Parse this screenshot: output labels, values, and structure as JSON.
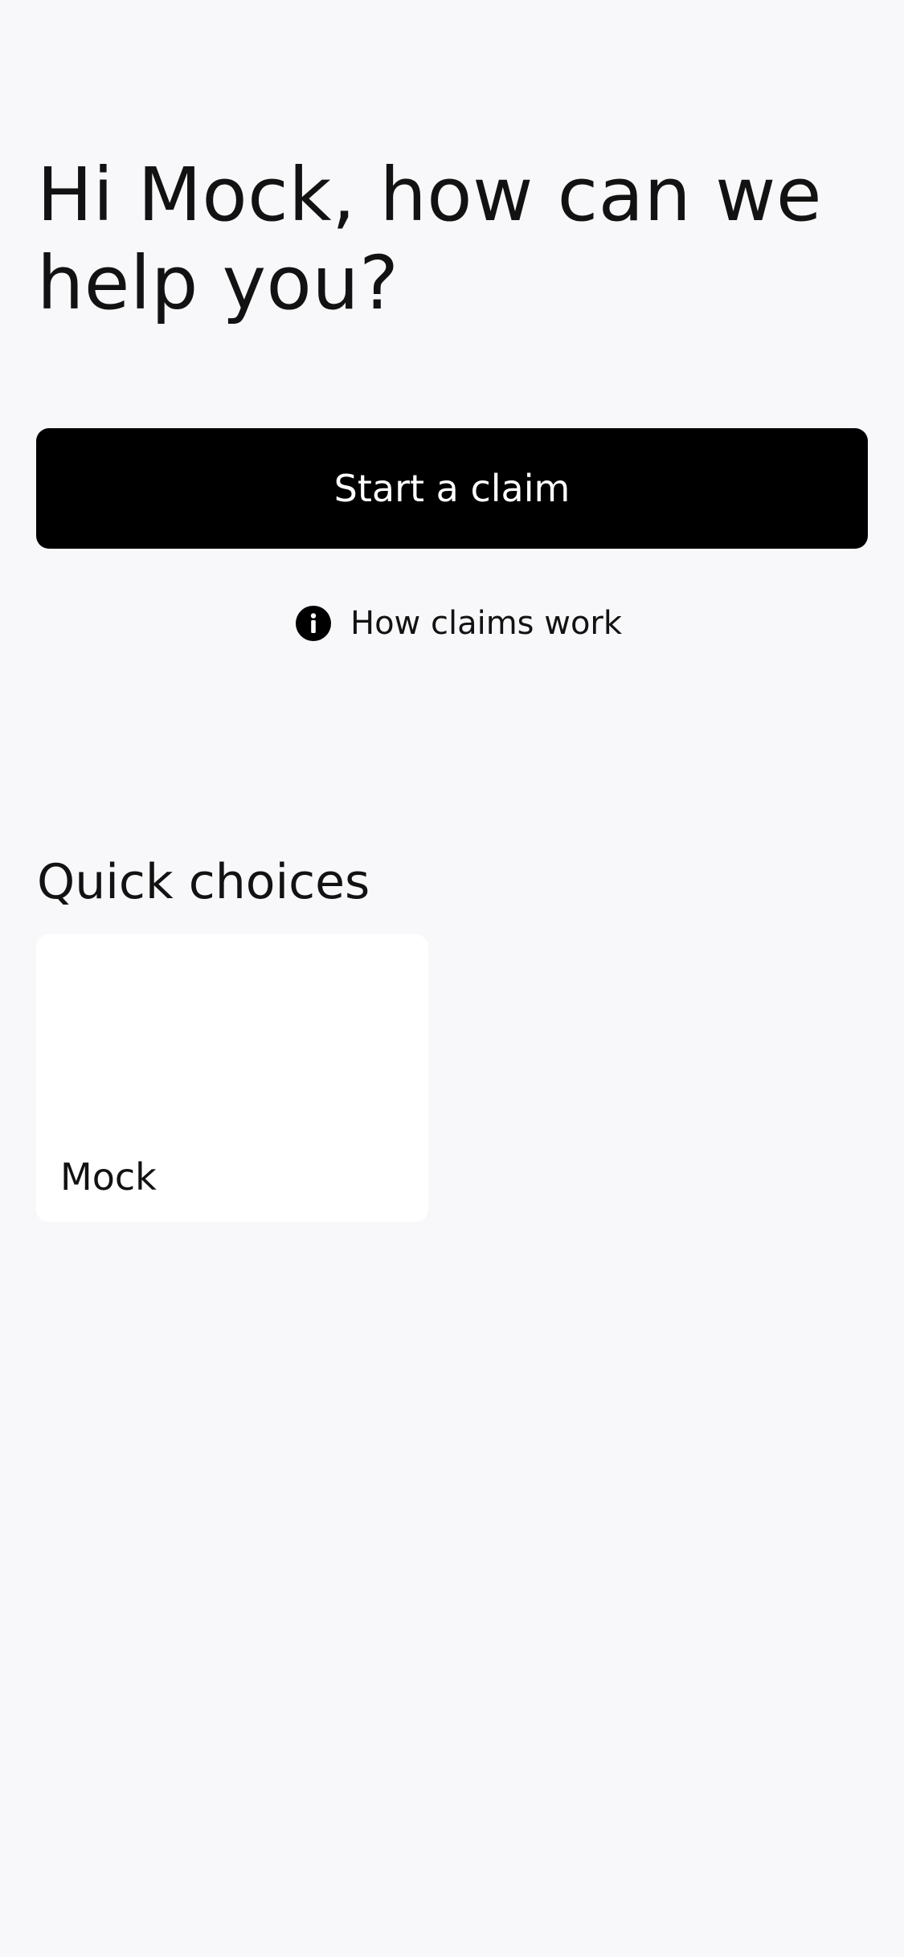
{
  "header": {
    "greeting": "Hi Mock, how can we help you?"
  },
  "actions": {
    "start_claim_label": "Start a claim",
    "how_claims_work_label": "How claims work",
    "how_claims_work_icon": "info-icon"
  },
  "quick_choices": {
    "title": "Quick choices",
    "items": [
      {
        "label": "Mock"
      }
    ]
  },
  "colors": {
    "background": "#f8f8fa",
    "primary_button": "#000000",
    "primary_button_text": "#ffffff",
    "card_background": "#ffffff",
    "text": "#121212"
  }
}
